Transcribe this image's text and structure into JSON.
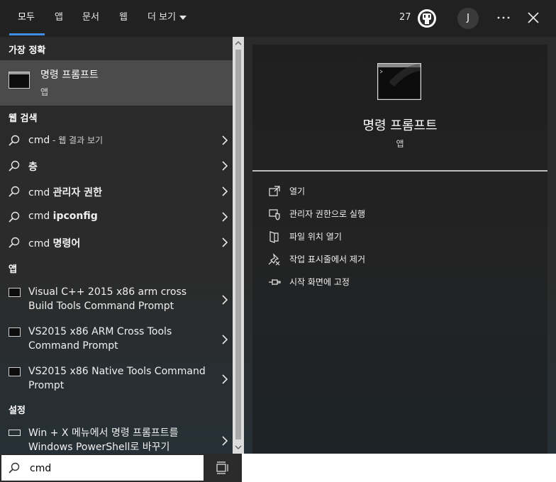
{
  "header": {
    "tabs": [
      {
        "label": "모두",
        "active": true
      },
      {
        "label": "앱"
      },
      {
        "label": "문서"
      },
      {
        "label": "웹"
      },
      {
        "label": "더 보기"
      }
    ],
    "points": "27",
    "avatar_letter": "J"
  },
  "results": {
    "best_match_heading": "가장 정확",
    "best_match": {
      "title": "명령 프롬프트",
      "subtitle": "앱",
      "icon": "cmd-icon"
    },
    "web_heading": "웹 검색",
    "web_items": [
      {
        "prefix": "cmd",
        "suffix": " - 웹 결과 보기"
      },
      {
        "prefix": "",
        "bold": "층"
      },
      {
        "prefix": "cmd ",
        "bold": "관리자 권한"
      },
      {
        "prefix": "cmd ",
        "bold": "ipconfig"
      },
      {
        "prefix": "cmd ",
        "bold": "명령어"
      }
    ],
    "apps_heading": "앱",
    "apps": [
      {
        "line1": "Visual C++ 2015 x86 arm cross",
        "line2": "Build Tools Command Prompt"
      },
      {
        "line1": "VS2015 x86 ARM Cross Tools",
        "line2": "Command Prompt"
      },
      {
        "line1": "VS2015 x86 Native Tools Command",
        "line2": "Prompt"
      }
    ],
    "settings_heading": "설정",
    "settings": [
      {
        "line1": "Win + X 메뉴에서 명령 프롬프트를",
        "line2": "Windows PowerShell로 바꾸기"
      }
    ]
  },
  "details": {
    "title": "명령 프롬프트",
    "subtitle": "앱",
    "actions": [
      {
        "label": "열기",
        "icon": "open-icon"
      },
      {
        "label": "관리자 권한으로 실행",
        "icon": "shield-icon"
      },
      {
        "label": "파일 위치 열기",
        "icon": "file-location-icon"
      },
      {
        "label": "작업 표시줄에서 제거",
        "icon": "unpin-icon"
      },
      {
        "label": "시작 화면에 고정",
        "icon": "pin-icon"
      }
    ]
  },
  "search": {
    "value": "cmd"
  },
  "colors": {
    "accent": "#3d8ee6",
    "selected_row": "#4b4b4b",
    "panel": "#1f1f1f"
  }
}
